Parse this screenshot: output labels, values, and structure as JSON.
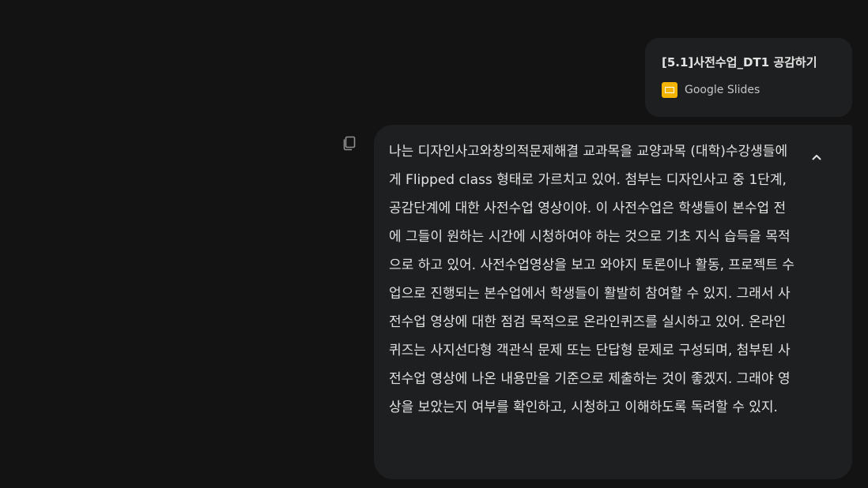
{
  "attachment": {
    "title": "[5.1]사전수업_DT1 공감하기",
    "source_label": "Google Slides",
    "source_icon": "google-slides-icon",
    "icon_color": "#f4b400"
  },
  "message": {
    "text": "나는 디자인사고와창의적문제해결 교과목을 교양과목 (대학)수강생들에게 Flipped class 형태로 가르치고 있어. 첨부는 디자인사고 중 1단계, 공감단계에 대한 사전수업 영상이야. 이 사전수업은 학생들이 본수업 전 에 그들이 원하는 시간에 시청하여야 하는 것으로 기초 지식 습득을 목적으로 하고 있어. 사전수업영상을 보고 와야지 토론이나 활동, 프로젝트 수업으로 진행되는 본수업에서 학생들이 활발히 참여할 수 있지. 그래서 사전수업 영상에 대한 점검 목적으로 온라인퀴즈를 실시하고 있어. 온라인퀴즈는 사지선다형 객관식 문제 또는 단답형 문제로 구성되며, 첨부된 사전수업 영상에 나온 내용만을 기준으로 제출하는 것이 좋겠지. 그래야 영상을 보았는지 여부를 확인하고, 시청하고 이해하도록 독려할 수 있지.",
    "copy_icon": "copy-icon",
    "collapse_icon": "chevron-up-icon"
  },
  "colors": {
    "background": "#131314",
    "bubble": "#1e1f20",
    "text": "#e3e3e3",
    "muted": "#c4c7c5"
  }
}
